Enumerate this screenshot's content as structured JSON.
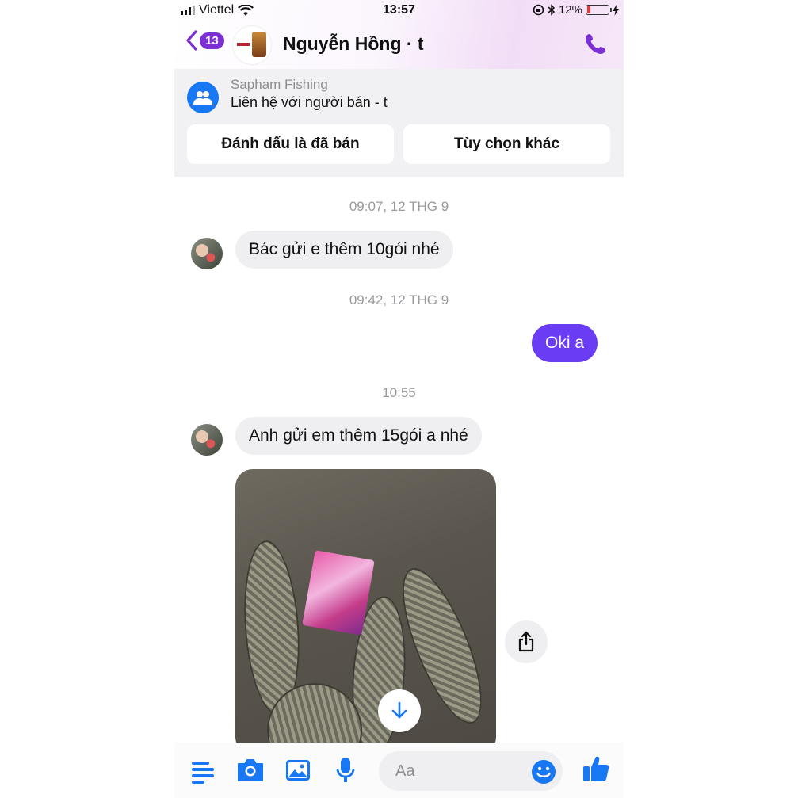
{
  "status_bar": {
    "carrier": "Viettel",
    "time": "13:57",
    "battery": "12%"
  },
  "header": {
    "back_badge": "13",
    "title": "Nguyễn Hồng · t"
  },
  "marketplace": {
    "shop_name": "Sapham Fishing",
    "subtitle": "Liên hệ với người bán - t",
    "mark_sold_label": "Đánh dấu là đã bán",
    "more_options_label": "Tùy chọn khác"
  },
  "messages": [
    {
      "timestamp": "09:07, 12 THG 9",
      "from": "them",
      "text": "Bác gửi e thêm 10gói nhé"
    },
    {
      "timestamp": "09:42, 12 THG 9",
      "from": "me",
      "text": "Oki a"
    },
    {
      "timestamp": "10:55",
      "from": "them",
      "text": "Anh gửi em thêm 15gói a nhé"
    }
  ],
  "composer": {
    "placeholder": "Aa"
  },
  "colors": {
    "accent": "#7b2fd4",
    "outgoing_bubble": "#6a3df5",
    "messenger_blue": "#1877f2"
  },
  "icons": [
    "back-chevron-icon",
    "phone-icon",
    "group-icon",
    "download-icon",
    "share-icon",
    "menu-icon",
    "camera-icon",
    "gallery-icon",
    "microphone-icon",
    "emoji-icon",
    "like-icon"
  ]
}
